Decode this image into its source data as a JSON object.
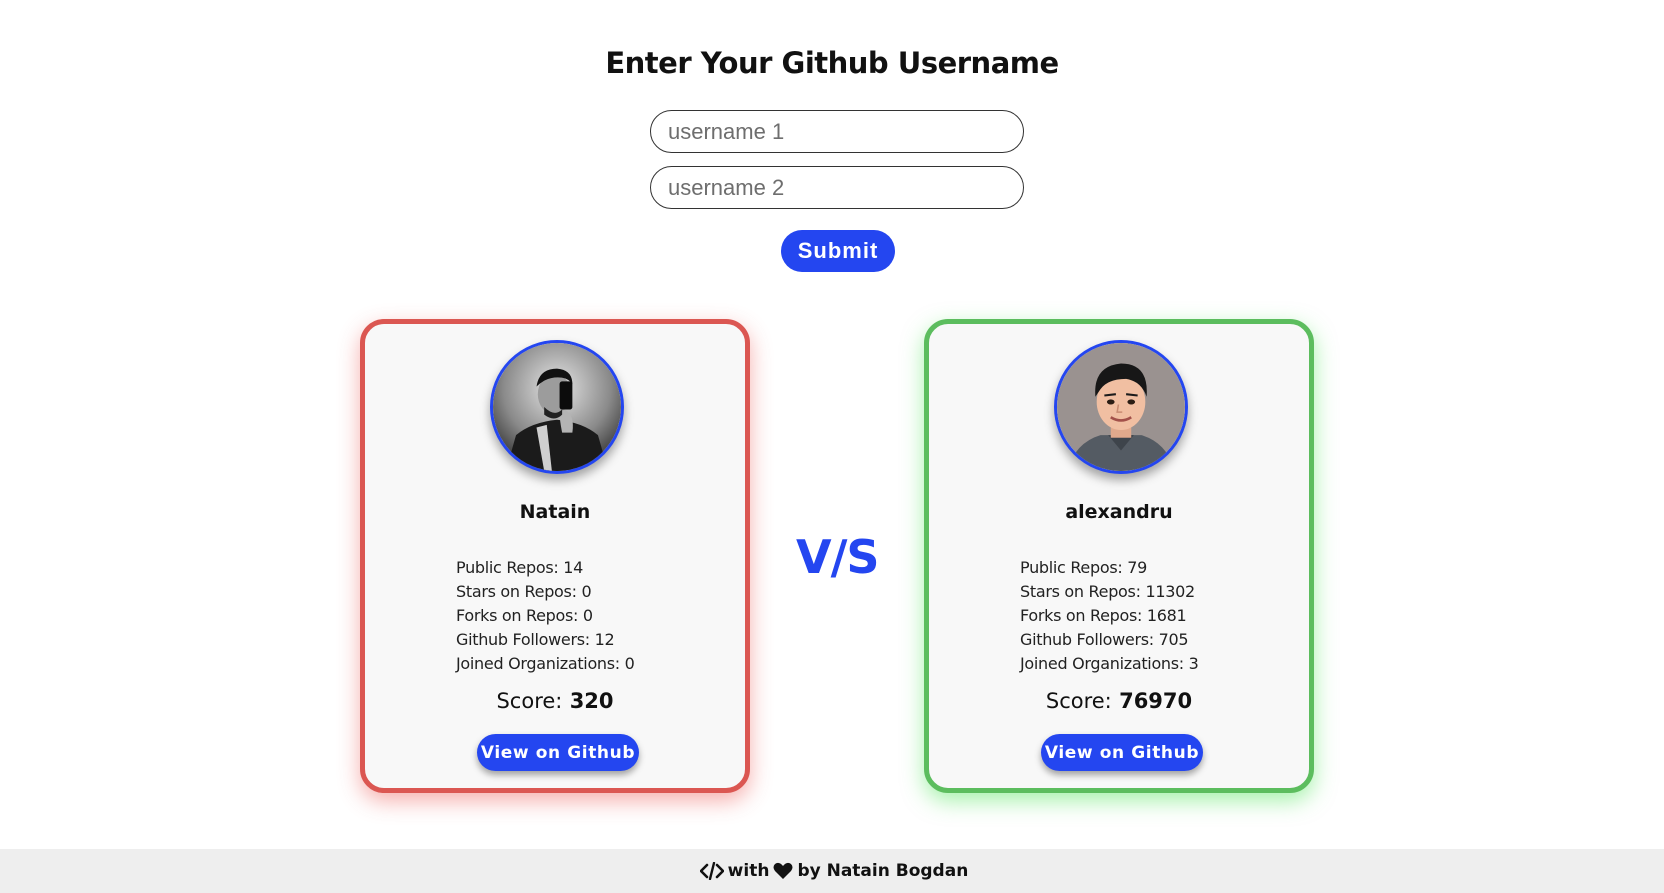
{
  "form": {
    "heading": "Enter Your Github Username",
    "username1_placeholder": "username 1",
    "username2_placeholder": "username 2",
    "submit_label": "Submit"
  },
  "vs_label": "V/S",
  "cards": [
    {
      "name": "Natain",
      "outcome_color": "#db5752",
      "stats": [
        "Public Repos: 14",
        "Stars on Repos: 0",
        "Forks on Repos: 0",
        "Github Followers: 12",
        "Joined Organizations: 0"
      ],
      "score_label": "Score:",
      "score_value": "320",
      "button_label": "View on Github"
    },
    {
      "name": "alexandru",
      "outcome_color": "#5cbd5e",
      "stats": [
        "Public Repos: 79",
        "Stars on Repos: 11302",
        "Forks on Repos: 1681",
        "Github Followers: 705",
        "Joined Organizations: 3"
      ],
      "score_label": "Score:",
      "score_value": "76970",
      "button_label": "View on Github"
    }
  ],
  "footer": {
    "code_icon": "code-icon",
    "heart_icon": "heart-icon",
    "with_text": "with",
    "by_text": "by Natain Bogdan"
  },
  "colors": {
    "accent": "#2446f0",
    "footer_bg": "#eeeeee"
  }
}
